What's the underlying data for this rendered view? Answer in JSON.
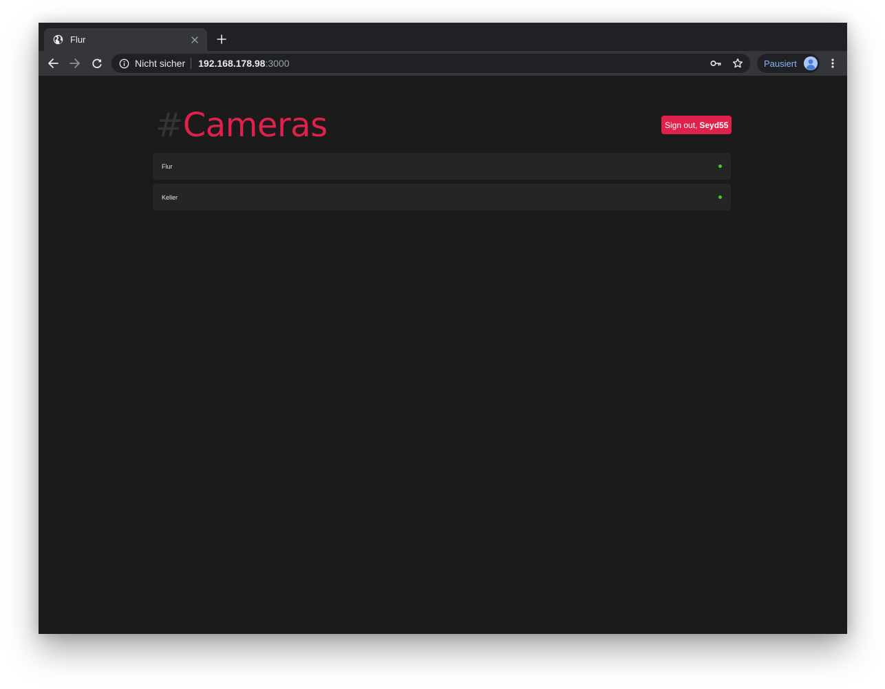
{
  "browser": {
    "tab": {
      "title": "Flur",
      "favicon": "globe-icon",
      "close_glyph": "✕"
    },
    "new_tab": "plus-icon",
    "toolbar": {
      "back": "arrow-left-icon",
      "forward": "arrow-right-icon",
      "reload": "reload-icon",
      "security_icon": "info-icon",
      "security_label": "Nicht sicher",
      "url_host": "192.168.178.98",
      "url_port": ":3000",
      "key": "key-icon",
      "bookmark": "star-icon",
      "profile_label": "Pausiert",
      "menu": "kebab-menu-icon"
    }
  },
  "page": {
    "title_hash": "#",
    "title": "Cameras",
    "signout_label": "Sign out,",
    "signout_user": "Seyd55",
    "cameras": [
      {
        "name": "Flur",
        "status": "online"
      },
      {
        "name": "Keller",
        "status": "online"
      }
    ]
  },
  "colors": {
    "accent": "#e0214c",
    "status_online": "#3ecf1f",
    "background": "#1b1b1c",
    "row": "#252526"
  }
}
